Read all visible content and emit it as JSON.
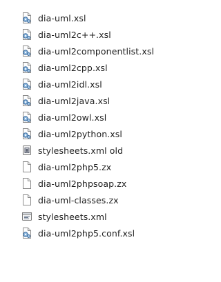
{
  "files": [
    {
      "name": "dia-uml.xsl",
      "icon": "xsl-file-icon"
    },
    {
      "name": "dia-uml2c++.xsl",
      "icon": "xsl-file-icon"
    },
    {
      "name": "dia-uml2componentlist.xsl",
      "icon": "xsl-file-icon"
    },
    {
      "name": "dia-uml2cpp.xsl",
      "icon": "xsl-file-icon"
    },
    {
      "name": "dia-uml2idl.xsl",
      "icon": "xsl-file-icon"
    },
    {
      "name": "dia-uml2java.xsl",
      "icon": "xsl-file-icon"
    },
    {
      "name": "dia-uml2owl.xsl",
      "icon": "xsl-file-icon"
    },
    {
      "name": "dia-uml2python.xsl",
      "icon": "xsl-file-icon"
    },
    {
      "name": "stylesheets.xml old",
      "icon": "system-file-icon"
    },
    {
      "name": "dia-uml2php5.zx",
      "icon": "blank-file-icon"
    },
    {
      "name": "dia-uml2phpsoap.zx",
      "icon": "blank-file-icon"
    },
    {
      "name": "dia-uml-classes.zx",
      "icon": "blank-file-icon"
    },
    {
      "name": "stylesheets.xml",
      "icon": "xml-file-icon"
    },
    {
      "name": "dia-uml2php5.conf.xsl",
      "icon": "xsl-file-icon"
    }
  ]
}
